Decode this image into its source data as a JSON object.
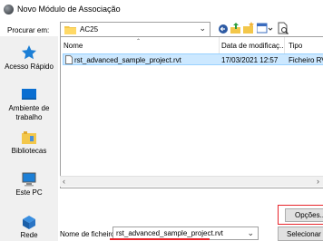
{
  "window": {
    "title": "Novo Módulo de Associação"
  },
  "toolbar": {
    "look_in_label": "Procurar em:",
    "look_in_value": "AC25"
  },
  "places": [
    {
      "label": "Acesso Rápido",
      "icon": "star-icon"
    },
    {
      "label": "Ambiente de trabalho",
      "icon": "desktop-icon"
    },
    {
      "label": "Bibliotecas",
      "icon": "libraries-icon"
    },
    {
      "label": "Este PC",
      "icon": "computer-icon"
    },
    {
      "label": "Rede",
      "icon": "network-icon"
    }
  ],
  "filelist": {
    "columns": [
      "Nome",
      "Data de modificaç...",
      "Tipo"
    ],
    "rows": [
      {
        "name": "rst_advanced_sample_project.rvt",
        "modified": "17/03/2021 12:57",
        "type": "Ficheiro RV"
      }
    ]
  },
  "buttons": {
    "options": "Opções...",
    "select": "Selecionar"
  },
  "filename": {
    "label": "Nome de ficheiro:",
    "value": "rst_advanced_sample_project.rvt"
  },
  "colors": {
    "selection": "#cce8ff",
    "highlight": "#e8242b"
  }
}
